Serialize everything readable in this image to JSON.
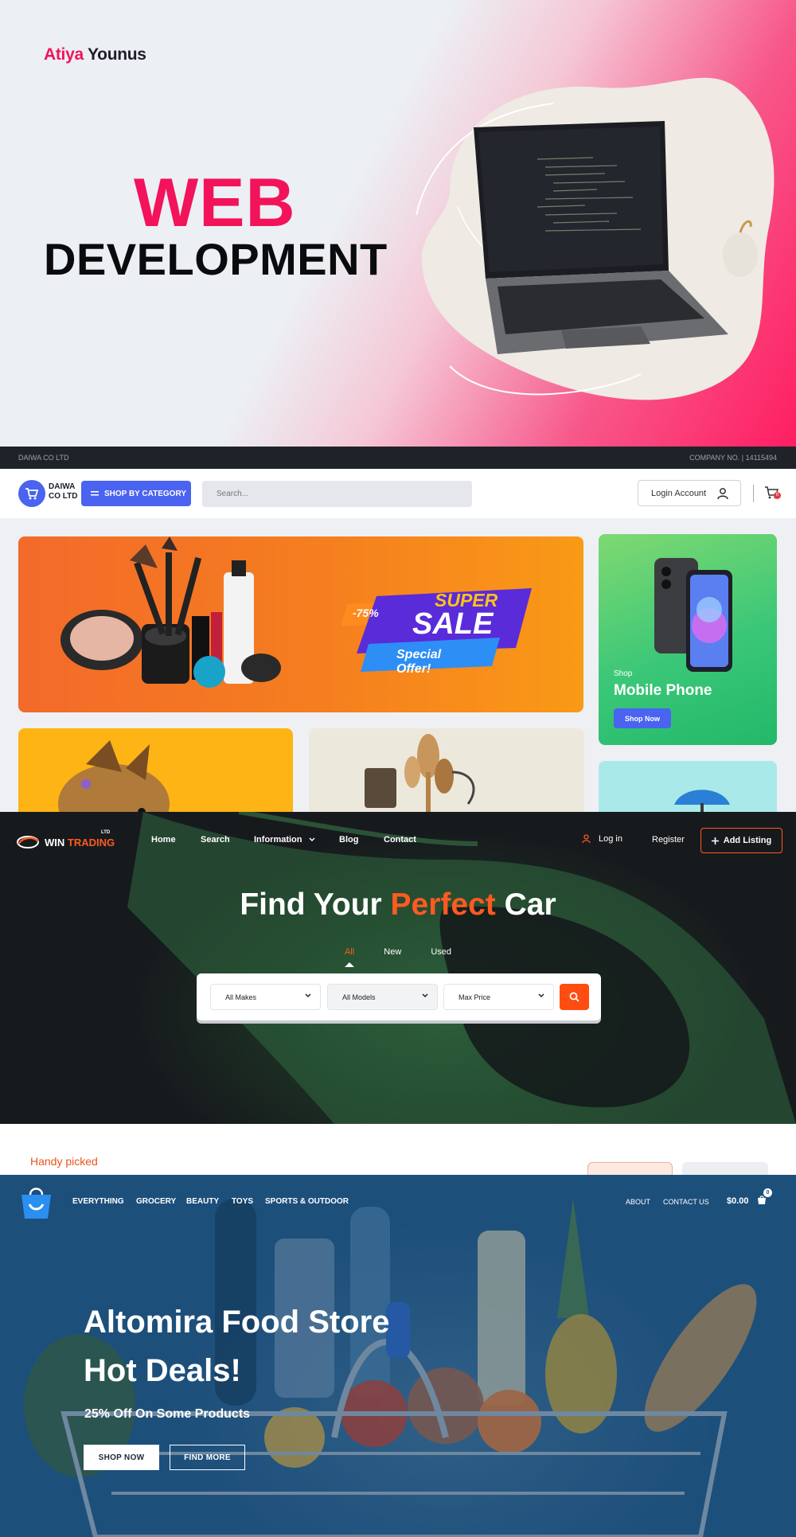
{
  "web_dev": {
    "brand_first": "Atiya",
    "brand_last": "Younus",
    "title_top": "WEB",
    "title_bottom": "DEVELOPMENT"
  },
  "daiwa": {
    "topbar_left": "DAIWA CO LTD",
    "topbar_right": "COMPANY NO. | 14115494",
    "logo_text": "DAIWA CO LTD",
    "shop_by_category": "SHOP BY CATEGORY",
    "search_placeholder": "Search...",
    "login": "Login Account",
    "cart_count": "0",
    "banner": {
      "discount": "-75%",
      "super": "SUPER",
      "sale": "SALE",
      "offer": "Special Offer!"
    },
    "side_card": {
      "label": "Shop",
      "title": "Mobile Phone",
      "button": "Shop Now"
    }
  },
  "win_trading": {
    "logo_name": "WIN",
    "logo_accent": "TRADING",
    "logo_ltd": "LTD",
    "nav": [
      "Home",
      "Search",
      "Information",
      "Blog",
      "Contact"
    ],
    "login": "Log in",
    "register": "Register",
    "add_listing": "Add Listing",
    "title_before": "Find Your ",
    "title_accent": "Perfect",
    "title_after": " Car",
    "tabs": [
      "All",
      "New",
      "Used"
    ],
    "selects": [
      "All Makes",
      "All Models",
      "Max Price"
    ],
    "handy": "Handy picked"
  },
  "altomira": {
    "nav": [
      "EVERYTHING",
      "GROCERY",
      "BEAUTY",
      "TOYS",
      "SPORTS & OUTDOOR"
    ],
    "nav_right": [
      "ABOUT",
      "CONTACT US"
    ],
    "price": "$0.00",
    "cart_count": "0",
    "title_line1": "Altomira Food Store",
    "title_line2": "Hot Deals!",
    "subtitle": "25% Off On Some Products",
    "btn_shop": "SHOP NOW",
    "btn_find": "FIND MORE"
  },
  "colors": {
    "web_pink": "#f2135a",
    "daiwa_blue": "#4a63f0",
    "win_orange": "#ff5a1f",
    "altomira_blue": "#1e4f7b"
  }
}
